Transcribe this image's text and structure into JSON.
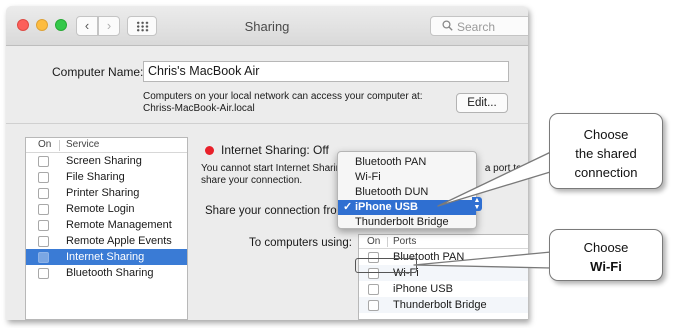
{
  "window": {
    "title": "Sharing",
    "nav_back": "‹",
    "nav_forward": "›",
    "search_placeholder": "Search"
  },
  "computer_name": {
    "label": "Computer Name:",
    "value": "Chris's MacBook Air",
    "help_line1": "Computers on your local network can access your computer at:",
    "help_line2": "Chriss-MacBook-Air.local",
    "edit_button": "Edit..."
  },
  "services": {
    "col_on": "On",
    "col_service": "Service",
    "items": [
      {
        "label": "Screen Sharing",
        "checked": false,
        "selected": false
      },
      {
        "label": "File Sharing",
        "checked": false,
        "selected": false
      },
      {
        "label": "Printer Sharing",
        "checked": false,
        "selected": false
      },
      {
        "label": "Remote Login",
        "checked": false,
        "selected": false
      },
      {
        "label": "Remote Management",
        "checked": false,
        "selected": false
      },
      {
        "label": "Remote Apple Events",
        "checked": false,
        "selected": false
      },
      {
        "label": "Internet Sharing",
        "checked": false,
        "selected": true
      },
      {
        "label": "Bluetooth Sharing",
        "checked": false,
        "selected": false
      }
    ]
  },
  "internet_sharing": {
    "status": "Internet Sharing: Off",
    "status_color": "#e8202a",
    "info_line1_start": "You cannot start Internet Sharing",
    "info_line1_end": "a port to",
    "info_line2": "share your connection.",
    "share_from_label": "Share your connection from",
    "to_computers_label": "To computers using:"
  },
  "share_from_menu": {
    "options": [
      "Bluetooth PAN",
      "Wi-Fi",
      "Bluetooth DUN",
      "iPhone USB",
      "Thunderbolt Bridge"
    ],
    "selected": "iPhone USB",
    "check_glyph": "✓"
  },
  "ports": {
    "col_on": "On",
    "col_ports": "Ports",
    "items": [
      {
        "label": "Bluetooth PAN",
        "checked": false
      },
      {
        "label": "Wi-Fi",
        "checked": false
      },
      {
        "label": "iPhone USB",
        "checked": false
      },
      {
        "label": "Thunderbolt Bridge",
        "checked": false
      }
    ]
  },
  "callouts": {
    "first": {
      "line1": "Choose",
      "line2": "the shared",
      "line3": "connection"
    },
    "second": {
      "line1": "Choose",
      "line2": "Wi-Fi"
    }
  },
  "colors": {
    "selection_blue": "#3a7bd5",
    "menu_highlight": "#2f6fd1"
  }
}
